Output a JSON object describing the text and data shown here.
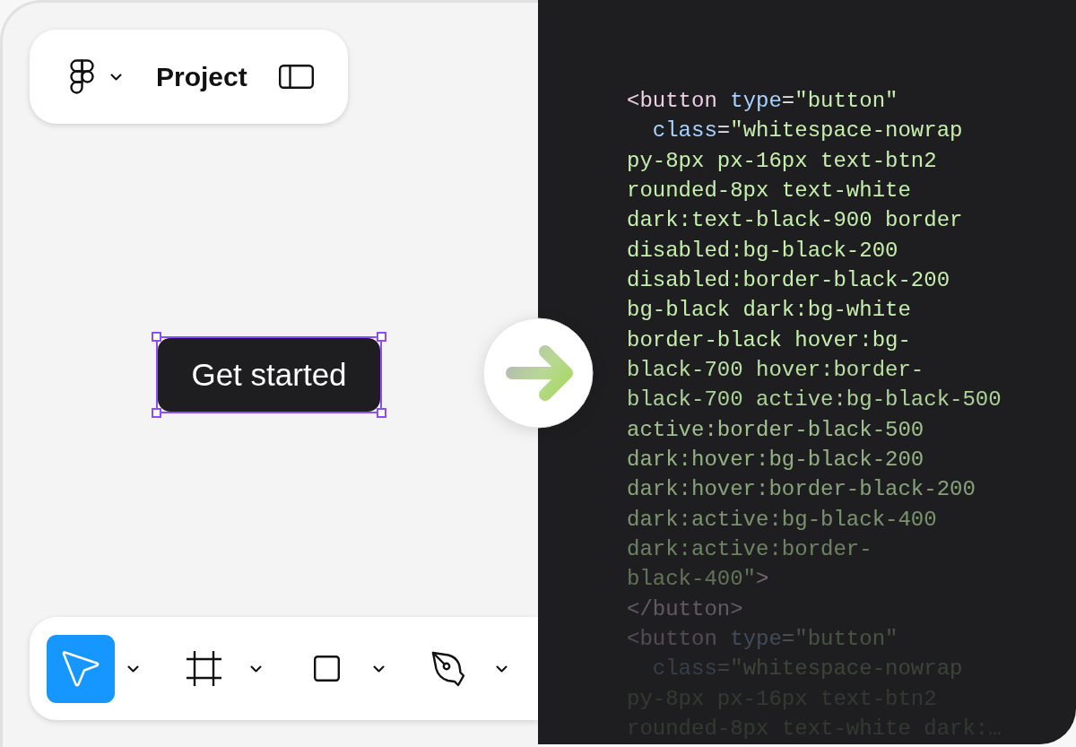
{
  "top_bar": {
    "project_name": "Project"
  },
  "canvas": {
    "button": {
      "label": "Get started",
      "selected": true
    }
  },
  "toolbar": {
    "tools": [
      {
        "kind": "pointer",
        "selected": true
      },
      {
        "kind": "frame",
        "selected": false
      },
      {
        "kind": "rectangle",
        "selected": false
      },
      {
        "kind": "pen",
        "selected": false
      }
    ]
  },
  "code": {
    "lines": [
      [
        {
          "kind": "tag",
          "text": "<button"
        },
        {
          "kind": "attr",
          "text": " type"
        },
        {
          "kind": "punct",
          "text": "="
        },
        {
          "kind": "string",
          "text": "\"button\""
        }
      ],
      [
        {
          "kind": "attr",
          "text": "  class"
        },
        {
          "kind": "punct",
          "text": "="
        },
        {
          "kind": "string",
          "text": "\"whitespace-nowrap"
        }
      ],
      [
        {
          "kind": "string",
          "text": "py-8px px-16px text-btn2"
        }
      ],
      [
        {
          "kind": "string",
          "text": "rounded-8px text-white"
        }
      ],
      [
        {
          "kind": "string",
          "text": "dark:text-black-900 border"
        }
      ],
      [
        {
          "kind": "string",
          "text": "disabled:bg-black-200"
        }
      ],
      [
        {
          "kind": "string",
          "text": "disabled:border-black-200"
        }
      ],
      [
        {
          "kind": "string",
          "text": "bg-black dark:bg-white"
        }
      ],
      [
        {
          "kind": "string",
          "text": "border-black hover:bg-"
        }
      ],
      [
        {
          "kind": "string",
          "text": "black-700 hover:border-"
        }
      ],
      [
        {
          "kind": "string",
          "text": "black-700 active:bg-black-500"
        }
      ],
      [
        {
          "kind": "string",
          "text": "active:border-black-500"
        }
      ],
      [
        {
          "kind": "string",
          "text": "dark:hover:bg-black-200"
        }
      ],
      [
        {
          "kind": "string",
          "text": "dark:hover:border-black-200"
        }
      ],
      [
        {
          "kind": "string",
          "text": "dark:active:bg-black-400"
        }
      ],
      [
        {
          "kind": "string",
          "text": "dark:active:border-"
        }
      ],
      [
        {
          "kind": "string",
          "text": "black-400\""
        },
        {
          "kind": "tag",
          "text": ">"
        }
      ],
      [
        {
          "kind": "tag",
          "text": "</button>"
        }
      ],
      [
        {
          "kind": "tag",
          "text": "<button"
        },
        {
          "kind": "attr",
          "text": " type"
        },
        {
          "kind": "punct",
          "text": "="
        },
        {
          "kind": "string",
          "text": "\"button\""
        }
      ],
      [
        {
          "kind": "attr",
          "text": "  class"
        },
        {
          "kind": "punct",
          "text": "="
        },
        {
          "kind": "string",
          "text": "\"whitespace-nowrap"
        }
      ],
      [
        {
          "kind": "string",
          "text": "py-8px px-16px text-btn2"
        }
      ],
      [
        {
          "kind": "string",
          "text": "rounded-8px text-white dark:…"
        }
      ]
    ]
  }
}
